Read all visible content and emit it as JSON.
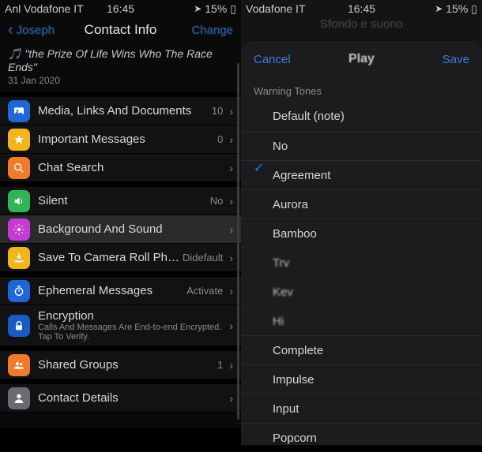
{
  "left": {
    "status": {
      "carrier": "Anl Vodafone IT",
      "time": "16:45",
      "battery": "15%"
    },
    "nav": {
      "back": "Joseph",
      "title": "Contact Info",
      "action": "Change"
    },
    "bio": {
      "text": "\"the Prize Of Life Wins Who The Race Ends\"",
      "date": "31 Jan 2020"
    },
    "rows": {
      "media": {
        "label": "Media, Links And Documents",
        "meta": "10"
      },
      "important": {
        "label": "Important Messages",
        "meta": "0"
      },
      "search": {
        "label": "Chat Search"
      },
      "silent": {
        "label": "Silent",
        "meta": "No"
      },
      "background": {
        "label": "Background And Sound"
      },
      "save": {
        "label": "Save To Camera Roll Photo",
        "meta": "Didefault"
      },
      "ephemeral": {
        "label": "Ephemeral Messages",
        "meta": "Activate"
      },
      "encryption": {
        "label": "Encryption",
        "sub": "Calls And Messages Are End-to-end Encrypted. Tap To Verify."
      },
      "shared": {
        "label": "Shared Groups",
        "meta": "1"
      },
      "details": {
        "label": "Contact Details"
      }
    }
  },
  "right": {
    "status": {
      "carrier": "Vodafone IT",
      "time": "16:45",
      "battery": "15%"
    },
    "faded_header": "Sfondo e suono",
    "modal": {
      "cancel": "Cancel",
      "title": "Play",
      "save": "Save"
    },
    "section": "Warning Tones",
    "tones": [
      {
        "label": "Default (note)",
        "selected": false
      },
      {
        "label": "No",
        "selected": false
      },
      {
        "label": "Agreement",
        "selected": true
      },
      {
        "label": "Aurora",
        "selected": false
      },
      {
        "label": "Bamboo",
        "selected": false
      },
      {
        "label": "Trv",
        "selected": false,
        "blur": true
      },
      {
        "label": "Kev",
        "selected": false,
        "blur": true
      },
      {
        "label": "Hi",
        "selected": false,
        "blur": true
      },
      {
        "label": "Complete",
        "selected": false
      },
      {
        "label": "Impulse",
        "selected": false
      },
      {
        "label": "Input",
        "selected": false
      },
      {
        "label": "Popcorn",
        "selected": false
      }
    ]
  }
}
